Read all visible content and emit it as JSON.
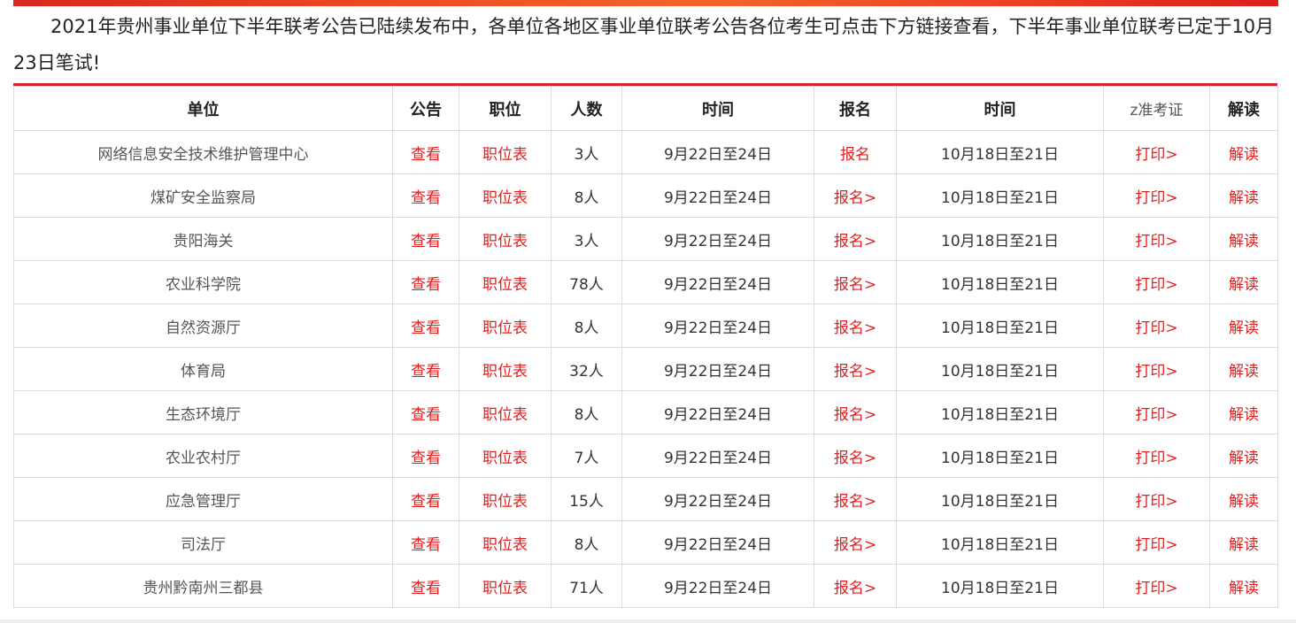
{
  "intro_text": "2021年贵州事业单位下半年联考公告已陆续发布中，各单位各地区事业单位联考公告各位考生可点击下方链接查看，下半年事业单位联考已定于10月23日笔试!",
  "headers": [
    "单位",
    "公告",
    "职位",
    "人数",
    "时间",
    "报名",
    "时间",
    "z准考证",
    "解读"
  ],
  "rows": [
    {
      "unit": "网络信息安全技术维护管理中心",
      "notice": "查看",
      "positions": "职位表",
      "count": "3人",
      "reg_time": "9月22日至24日",
      "register": "报名",
      "print_time": "10月18日至21日",
      "print": "打印>",
      "interpret": "解读"
    },
    {
      "unit": "煤矿安全监察局",
      "notice": "查看",
      "positions": "职位表",
      "count": "8人",
      "reg_time": "9月22日至24日",
      "register": "报名>",
      "print_time": "10月18日至21日",
      "print": "打印>",
      "interpret": "解读"
    },
    {
      "unit": "贵阳海关",
      "notice": "查看",
      "positions": "职位表",
      "count": "3人",
      "reg_time": "9月22日至24日",
      "register": "报名>",
      "print_time": "10月18日至21日",
      "print": "打印>",
      "interpret": "解读"
    },
    {
      "unit": "农业科学院",
      "notice": "查看",
      "positions": "职位表",
      "count": "78人",
      "reg_time": "9月22日至24日",
      "register": "报名>",
      "print_time": "10月18日至21日",
      "print": "打印>",
      "interpret": "解读"
    },
    {
      "unit": "自然资源厅",
      "notice": "查看",
      "positions": "职位表",
      "count": "8人",
      "reg_time": "9月22日至24日",
      "register": "报名>",
      "print_time": "10月18日至21日",
      "print": "打印>",
      "interpret": "解读"
    },
    {
      "unit": "体育局",
      "notice": "查看",
      "positions": "职位表",
      "count": "32人",
      "reg_time": "9月22日至24日",
      "register": "报名>",
      "print_time": "10月18日至21日",
      "print": "打印>",
      "interpret": "解读"
    },
    {
      "unit": "生态环境厅",
      "notice": "查看",
      "positions": "职位表",
      "count": "8人",
      "reg_time": "9月22日至24日",
      "register": "报名>",
      "print_time": "10月18日至21日",
      "print": "打印>",
      "interpret": "解读"
    },
    {
      "unit": "农业农村厅",
      "notice": "查看",
      "positions": "职位表",
      "count": "7人",
      "reg_time": "9月22日至24日",
      "register": "报名>",
      "print_time": "10月18日至21日",
      "print": "打印>",
      "interpret": "解读"
    },
    {
      "unit": "应急管理厅",
      "notice": "查看",
      "positions": "职位表",
      "count": "15人",
      "reg_time": "9月22日至24日",
      "register": "报名>",
      "print_time": "10月18日至21日",
      "print": "打印>",
      "interpret": "解读"
    },
    {
      "unit": "司法厅",
      "notice": "查看",
      "positions": "职位表",
      "count": "8人",
      "reg_time": "9月22日至24日",
      "register": "报名>",
      "print_time": "10月18日至21日",
      "print": "打印>",
      "interpret": "解读"
    },
    {
      "unit": "贵州黔南州三都县",
      "notice": "查看",
      "positions": "职位表",
      "count": "71人",
      "reg_time": "9月22日至24日",
      "register": "报名>",
      "print_time": "10月18日至21日",
      "print": "打印>",
      "interpret": "解读"
    }
  ],
  "colors": {
    "accent": "#d6202f",
    "link": "#e02020",
    "border": "#dcdcdc"
  }
}
